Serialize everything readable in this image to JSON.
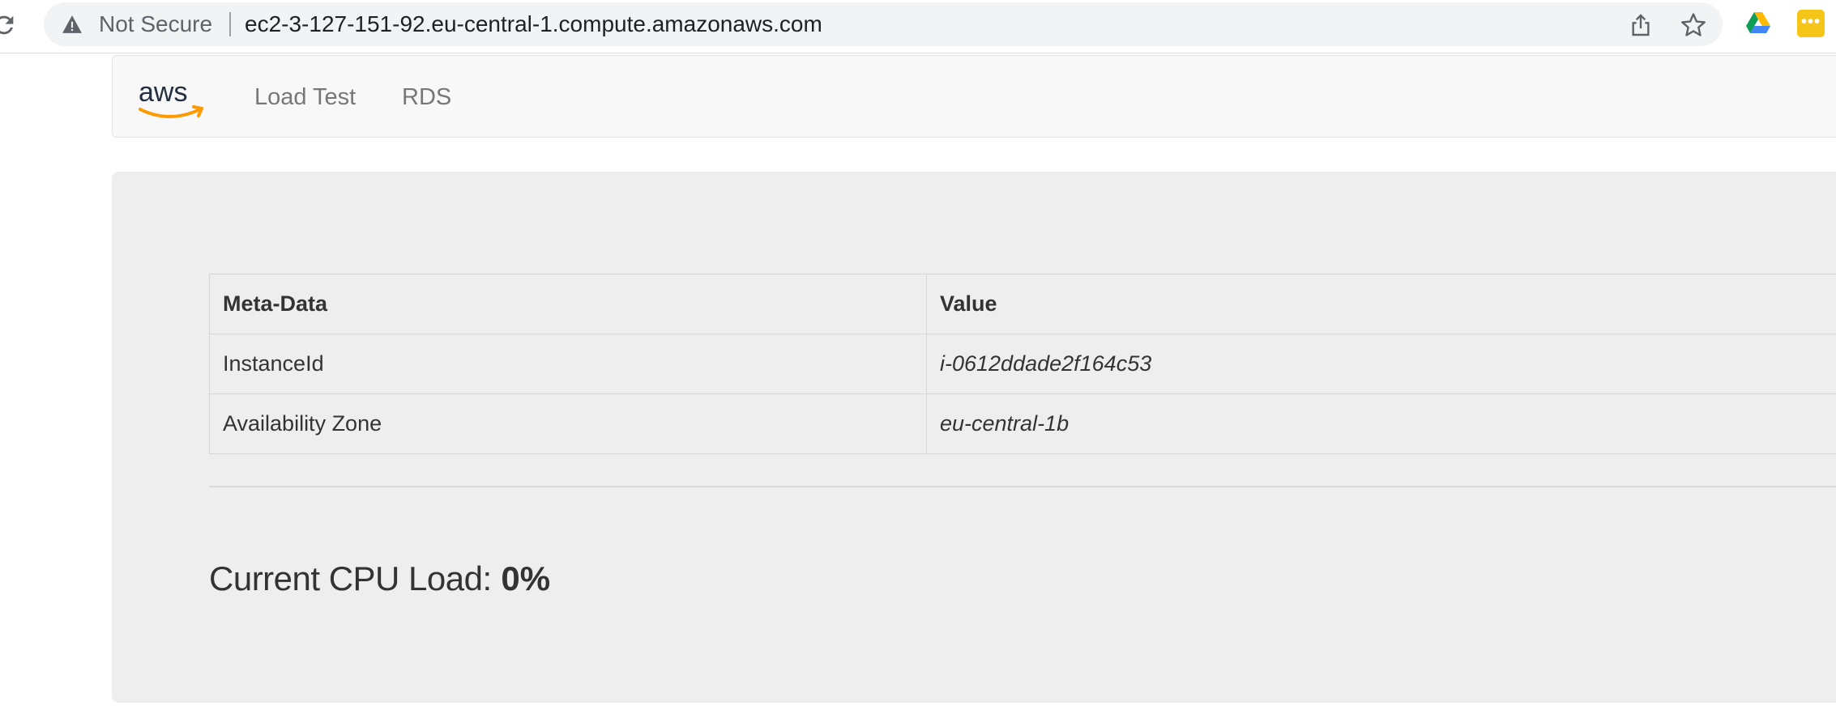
{
  "browser": {
    "security_label": "Not Secure",
    "url": "ec2-3-127-151-92.eu-central-1.compute.amazonaws.com",
    "icons": [
      "reload-icon",
      "warning-icon",
      "share-icon",
      "star-icon",
      "google-drive-icon",
      "extension-icon"
    ],
    "extension_glyph": "•••"
  },
  "navbar": {
    "logo": "aws",
    "links": [
      {
        "label": "Load Test"
      },
      {
        "label": "RDS"
      }
    ]
  },
  "metadata_table": {
    "headers": [
      "Meta-Data",
      "Value"
    ],
    "rows": [
      {
        "key": "InstanceId",
        "value": "i-0612ddade2f164c53"
      },
      {
        "key": "Availability Zone",
        "value": "eu-central-1b"
      }
    ]
  },
  "cpu": {
    "label": "Current CPU Load:",
    "value": "0%"
  },
  "colors": {
    "aws_orange": "#ff9900",
    "aws_navy": "#232f3e",
    "extension_yellow": "#f5c518"
  }
}
